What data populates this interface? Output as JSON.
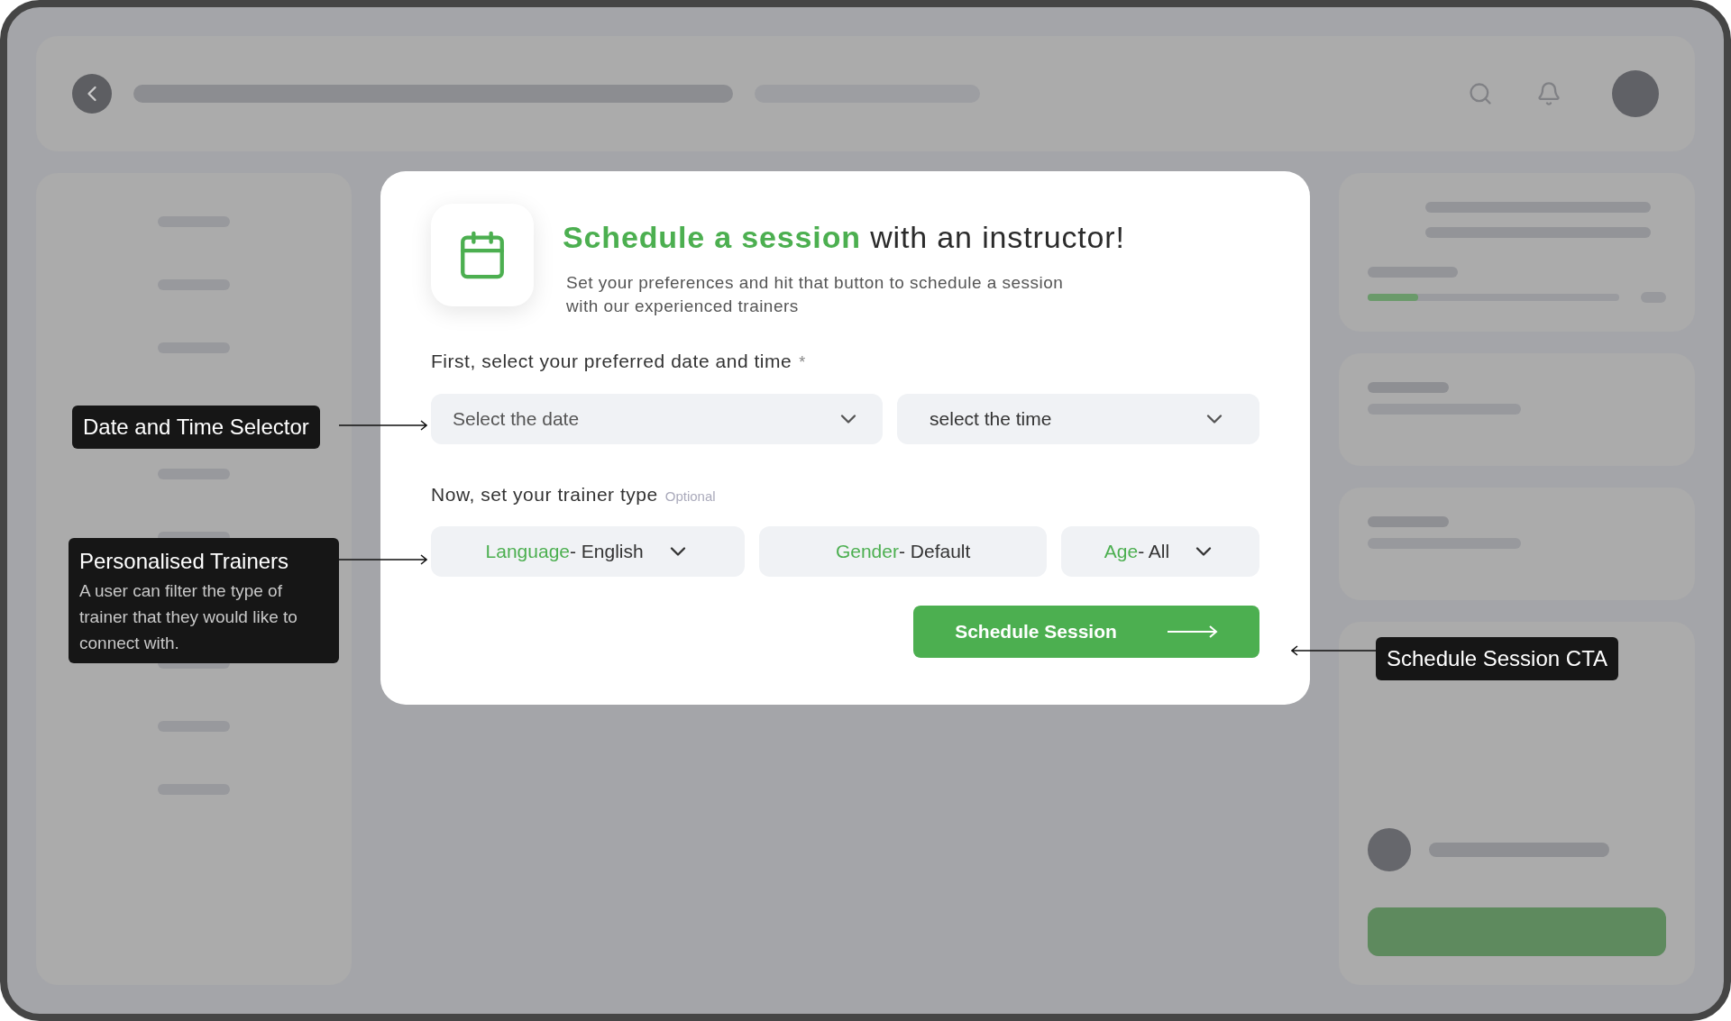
{
  "course_card": {
    "level": 0.2
  },
  "modal": {
    "title_highlight": "Schedule a session",
    "title_rest": "with an instructor!",
    "subtitle": "Set your preferences and hit that button to schedule a session with our experienced trainers",
    "date_time_label": "First, select your preferred date and time",
    "required_mark": "*",
    "date_placeholder": "Select the date",
    "time_placeholder": "select the time",
    "trainer_label": "Now, set your trainer type",
    "trainer_hint": "Optional",
    "filters": [
      {
        "label": "Language",
        "value": "- English",
        "dropdown": true
      },
      {
        "label": "Gender",
        "value": "- Default",
        "dropdown": false
      },
      {
        "label": "Age",
        "value": "- All",
        "dropdown": true
      }
    ],
    "submit": "Schedule Session"
  },
  "annotations": [
    {
      "title": "Date and Time Selector"
    },
    {
      "title": "Personalised Trainers",
      "description": "A user can filter the type of trainer that they would like to connect with."
    },
    {
      "title": "Schedule Session CTA"
    }
  ]
}
